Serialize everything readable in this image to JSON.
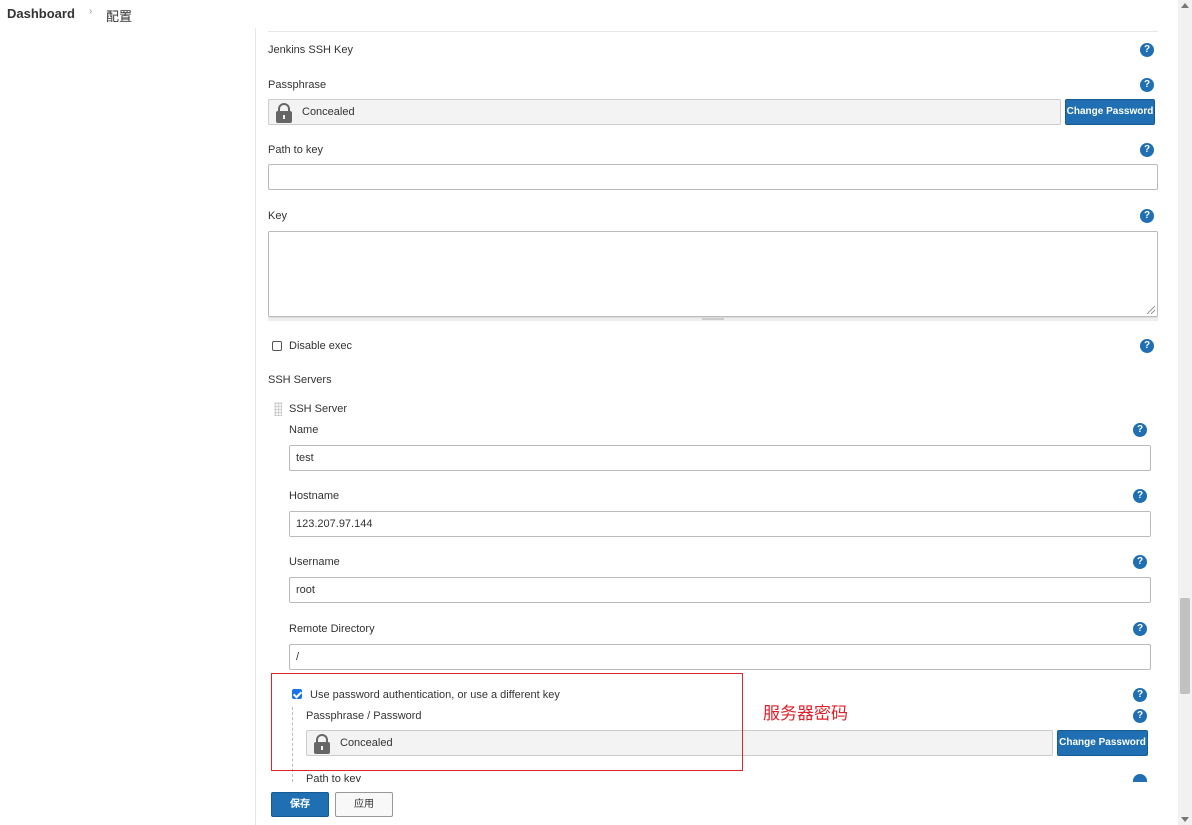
{
  "breadcrumb": {
    "dashboard": "Dashboard",
    "separator": "›",
    "current": "配置"
  },
  "help_glyph": "?",
  "jenkins_ssh_key": {
    "label": "Jenkins SSH Key"
  },
  "passphrase": {
    "label": "Passphrase",
    "value": "Concealed",
    "button": "Change Password"
  },
  "path_to_key": {
    "label": "Path to key",
    "value": ""
  },
  "key": {
    "label": "Key",
    "value": ""
  },
  "disable_exec": {
    "label": "Disable exec",
    "checked": false
  },
  "ssh_servers": {
    "label": "SSH Servers",
    "server_title": "SSH Server",
    "name": {
      "label": "Name",
      "value": "test"
    },
    "hostname": {
      "label": "Hostname",
      "value": "123.207.97.144"
    },
    "username": {
      "label": "Username",
      "value": "root"
    },
    "remote_directory": {
      "label": "Remote Directory",
      "value": "/"
    },
    "use_password": {
      "label": "Use password authentication, or use a different key",
      "checked": true
    },
    "passphrase_password": {
      "label": "Passphrase / Password",
      "value": "Concealed",
      "button": "Change Password"
    },
    "path_to_key_cut": "Path to key"
  },
  "annotation": {
    "text": "服务器密码",
    "color": "#e0202a"
  },
  "footer": {
    "save": "保存",
    "apply": "应用"
  },
  "colors": {
    "primary": "#1f6fb2",
    "annotation_box": "#d9262c"
  }
}
